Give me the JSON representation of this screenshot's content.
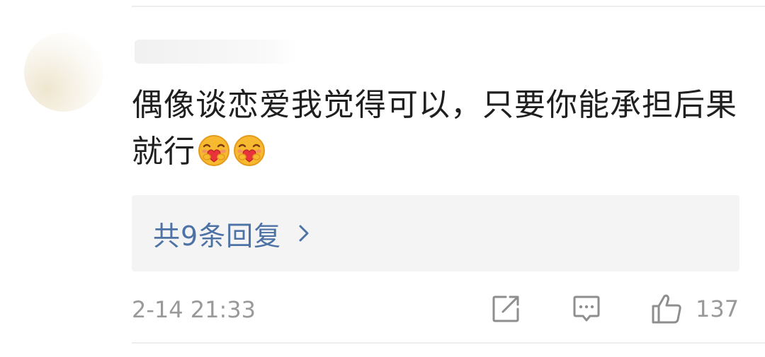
{
  "comment": {
    "author": "",
    "text": "偶像谈恋爱我觉得可以，只要你能承担后果就行",
    "emojis": [
      "hug-heart-emoji",
      "hug-heart-emoji"
    ],
    "timestamp": "2-14 21:33"
  },
  "replies": {
    "label": "共9条回复",
    "count": 9
  },
  "actions": {
    "share_icon": "share-edit-icon",
    "comment_icon": "comment-icon",
    "like_icon": "thumbs-up-icon",
    "like_count": "137"
  },
  "colors": {
    "text_primary": "#1f1f1f",
    "text_secondary": "#999999",
    "link_blue": "#4d72a6",
    "reply_background": "#f4f4f4",
    "divider": "#eeeeee"
  }
}
